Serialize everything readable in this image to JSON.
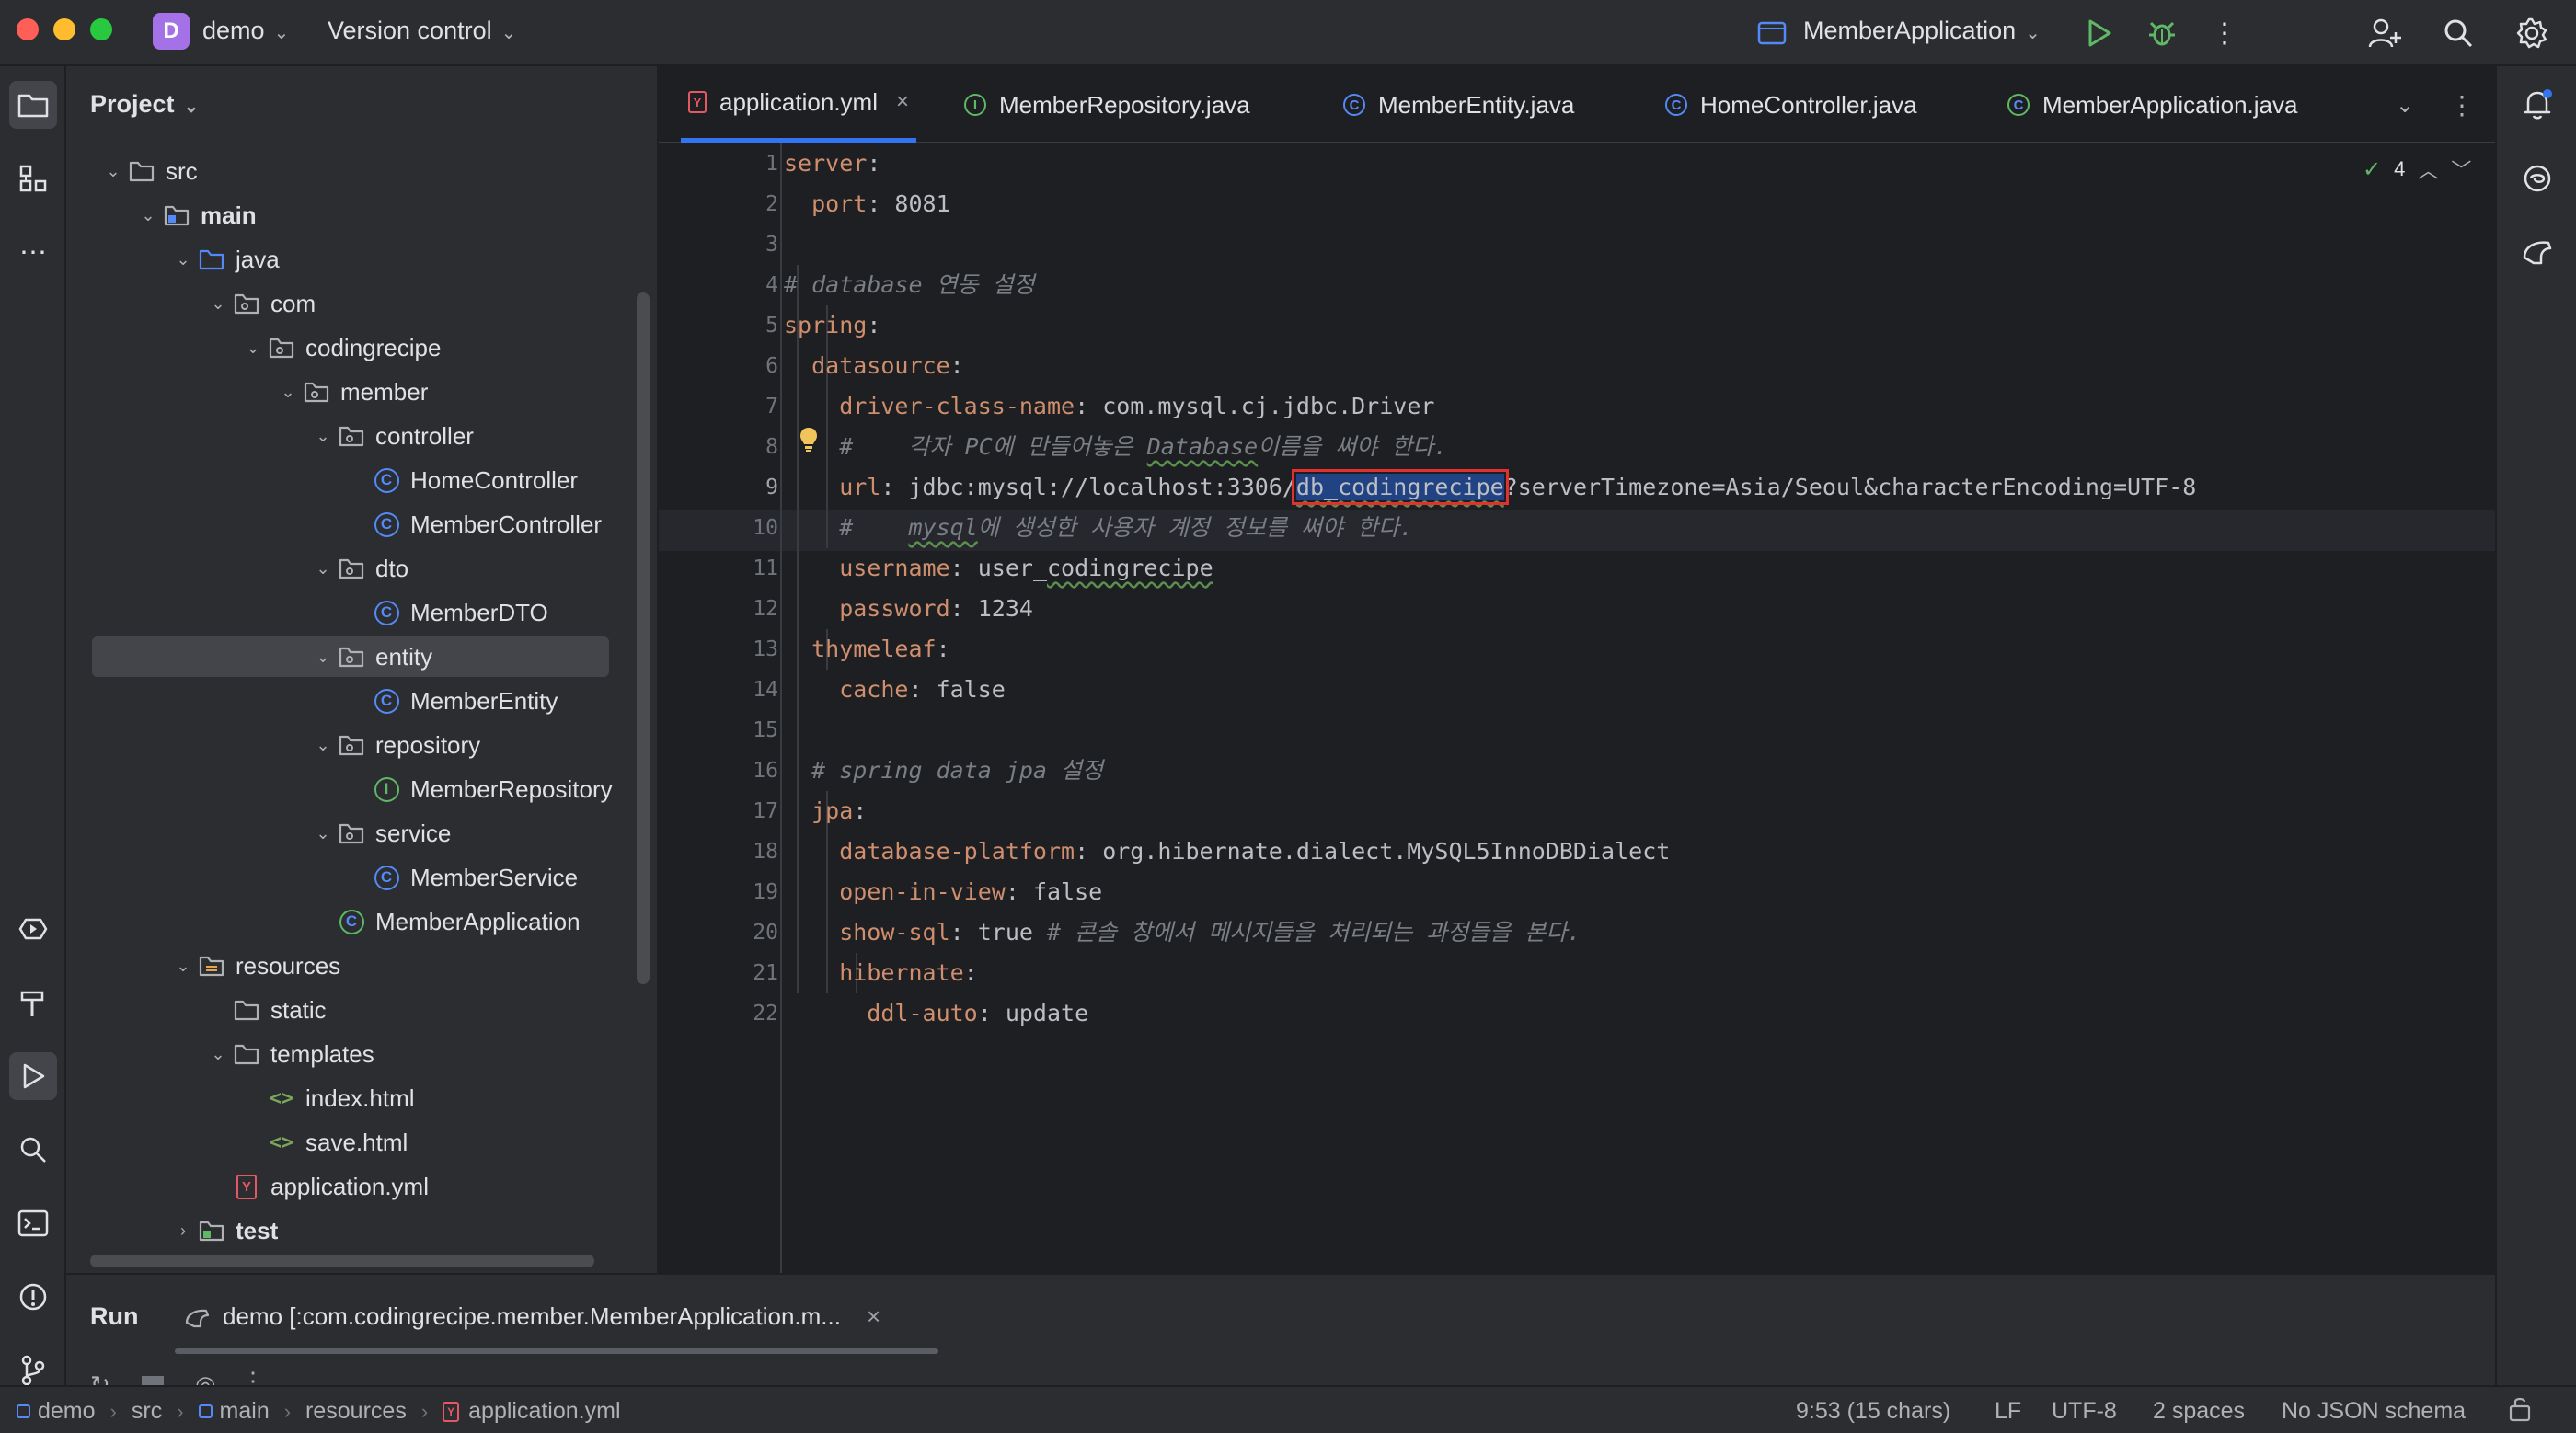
{
  "titlebar": {
    "project_badge": "D",
    "project_name": "demo",
    "vcs_label": "Version control",
    "run_config": "MemberApplication"
  },
  "project_panel": {
    "title": "Project",
    "tree": [
      {
        "label": "src",
        "type": "folder",
        "bold": false
      },
      {
        "label": "main",
        "type": "module-folder",
        "bold": true
      },
      {
        "label": "java",
        "type": "source-folder",
        "bold": false
      },
      {
        "label": "com",
        "type": "package",
        "bold": false
      },
      {
        "label": "codingrecipe",
        "type": "package",
        "bold": false
      },
      {
        "label": "member",
        "type": "package",
        "bold": false
      },
      {
        "label": "controller",
        "type": "package",
        "bold": false
      },
      {
        "label": "HomeController",
        "type": "class",
        "bold": false
      },
      {
        "label": "MemberController",
        "type": "class",
        "bold": false
      },
      {
        "label": "dto",
        "type": "package",
        "bold": false
      },
      {
        "label": "MemberDTO",
        "type": "class",
        "bold": false
      },
      {
        "label": "entity",
        "type": "package",
        "bold": false
      },
      {
        "label": "MemberEntity",
        "type": "class",
        "bold": false
      },
      {
        "label": "repository",
        "type": "package",
        "bold": false
      },
      {
        "label": "MemberRepository",
        "type": "interface",
        "bold": false
      },
      {
        "label": "service",
        "type": "package",
        "bold": false
      },
      {
        "label": "MemberService",
        "type": "class",
        "bold": false
      },
      {
        "label": "MemberApplication",
        "type": "app-class",
        "bold": false
      },
      {
        "label": "resources",
        "type": "resource-folder",
        "bold": false
      },
      {
        "label": "static",
        "type": "folder",
        "bold": false
      },
      {
        "label": "templates",
        "type": "folder",
        "bold": false
      },
      {
        "label": "index.html",
        "type": "html",
        "bold": false
      },
      {
        "label": "save.html",
        "type": "html",
        "bold": false
      },
      {
        "label": "application.yml",
        "type": "yml",
        "bold": false
      },
      {
        "label": "test",
        "type": "module-folder",
        "bold": true
      }
    ]
  },
  "tabs": [
    {
      "label": "application.yml",
      "icon": "yaml-icon",
      "active": true
    },
    {
      "label": "MemberRepository.java",
      "icon": "interface-icon",
      "active": false
    },
    {
      "label": "MemberEntity.java",
      "icon": "class-icon",
      "active": false
    },
    {
      "label": "HomeController.java",
      "icon": "class-icon",
      "active": false
    },
    {
      "label": "MemberApplication.java",
      "icon": "app-class-icon",
      "active": false
    }
  ],
  "editor": {
    "inspection_count": "4",
    "current_line": 9,
    "line_numbers": [
      "1",
      "2",
      "3",
      "4",
      "5",
      "6",
      "7",
      "8",
      "9",
      "10",
      "11",
      "12",
      "13",
      "14",
      "15",
      "16",
      "17",
      "18",
      "19",
      "20",
      "21",
      "22"
    ],
    "lines": [
      {
        "k": "server",
        "sep": ":",
        "v": ""
      },
      {
        "k": "  port",
        "sep": ":",
        "v": " 8081"
      },
      {
        "k": "",
        "sep": "",
        "v": ""
      },
      {
        "c": "# database 연동 설정"
      },
      {
        "k": "spring",
        "sep": ":",
        "v": ""
      },
      {
        "k": "  datasource",
        "sep": ":",
        "v": ""
      },
      {
        "k": "    driver-class-name",
        "sep": ":",
        "v": " com.mysql.cj.jdbc.Driver"
      },
      {
        "c1": "    #    각자 PC에 만들어놓은 ",
        "cu": "Database",
        "c2": "이름을 써야 한다."
      },
      {
        "k": "    url",
        "sep": ":",
        "v1": " jdbc:mysql://localhost:3306/",
        "hl": "db_codingrecipe",
        "v2": "?serverTimezone=Asia/Seoul&characterEncoding=UTF-8"
      },
      {
        "c1": "    #    ",
        "cu": "mysql",
        "c2": "에 생성한 사용자 계정 정보를 써야 한다."
      },
      {
        "k": "    username",
        "sep": ":",
        "v1": " user_",
        "vu": "codingrecipe"
      },
      {
        "k": "    password",
        "sep": ":",
        "v": " 1234"
      },
      {
        "k": "  thymeleaf",
        "sep": ":",
        "v": ""
      },
      {
        "k": "    cache",
        "sep": ":",
        "v": " false"
      },
      {
        "k": "",
        "sep": "",
        "v": ""
      },
      {
        "c": "  # spring data jpa 설정"
      },
      {
        "k": "  jpa",
        "sep": ":",
        "v": ""
      },
      {
        "k": "    database-platform",
        "sep": ":",
        "v": " org.hibernate.dialect.MySQL5InnoDBDialect"
      },
      {
        "k": "    open-in-view",
        "sep": ":",
        "v": " false"
      },
      {
        "k": "    show-sql",
        "sep": ":",
        "v": " true ",
        "tc": "# 콘솔 창에서 메시지들을 처리되는 과정들을 본다."
      },
      {
        "k": "    hibernate",
        "sep": ":",
        "v": ""
      },
      {
        "k": "      ddl-auto",
        "sep": ":",
        "v": " update"
      }
    ]
  },
  "run_panel": {
    "label": "Run",
    "tab": "demo [:com.codingrecipe.member.MemberApplication.m..."
  },
  "statusbar": {
    "breadcrumb": [
      "demo",
      "src",
      "main",
      "resources",
      "application.yml"
    ],
    "position": "9:53 (15 chars)",
    "line_sep": "LF",
    "encoding": "UTF-8",
    "indent": "2 spaces",
    "schema": "No JSON schema"
  },
  "colors": {
    "accent": "#3574f0",
    "key": "#cf8e6d",
    "comment": "#7a7e85",
    "selection": "#214283",
    "highlight_box": "#e03030"
  }
}
